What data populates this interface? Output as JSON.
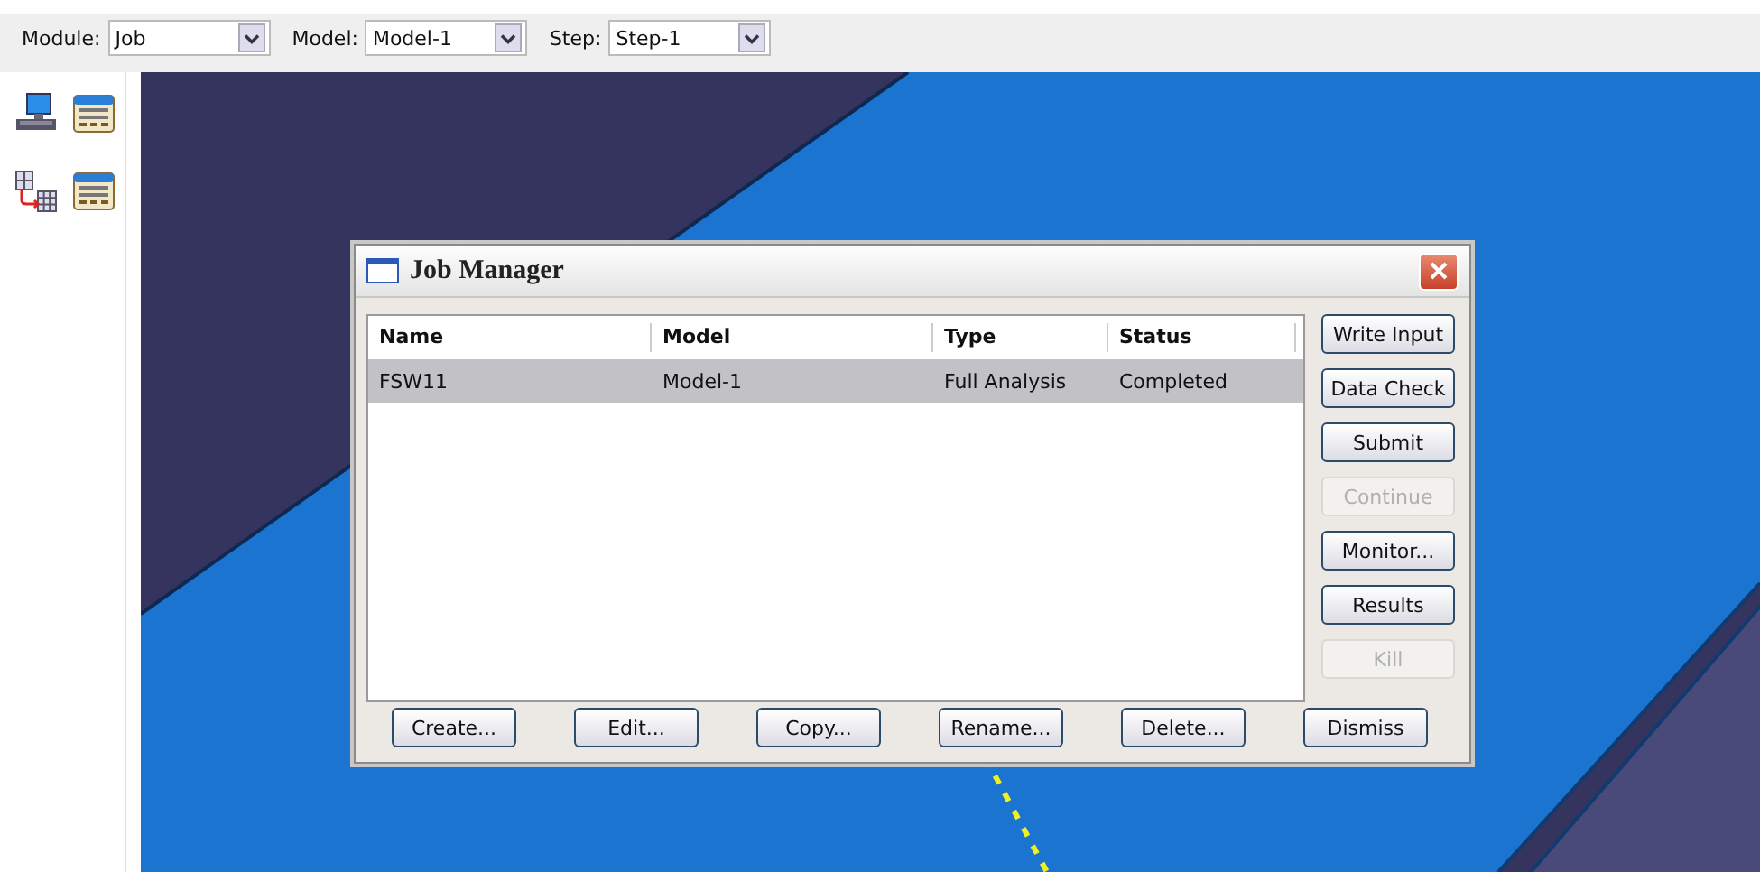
{
  "toolbar": {
    "fields": [
      {
        "label": "Module:",
        "value": "Job"
      },
      {
        "label": "Model:",
        "value": "Model-1"
      },
      {
        "label": "Step:",
        "value": "Step-1"
      }
    ]
  },
  "dialog": {
    "title": "Job Manager",
    "columns": [
      "Name",
      "Model",
      "Type",
      "Status"
    ],
    "rows": [
      {
        "cells": [
          "FSW11",
          "Model-1",
          "Full Analysis",
          "Completed"
        ],
        "selected": true
      }
    ],
    "side_buttons": [
      {
        "label": "Write Input",
        "disabled": false
      },
      {
        "label": "Data Check",
        "disabled": false
      },
      {
        "label": "Submit",
        "disabled": false
      },
      {
        "label": "Continue",
        "disabled": true
      },
      {
        "label": "Monitor...",
        "disabled": false
      },
      {
        "label": "Results",
        "disabled": false
      },
      {
        "label": "Kill",
        "disabled": true
      }
    ],
    "bottom_buttons": [
      "Create...",
      "Edit...",
      "Copy...",
      "Rename...",
      "Delete...",
      "Dismiss"
    ]
  }
}
